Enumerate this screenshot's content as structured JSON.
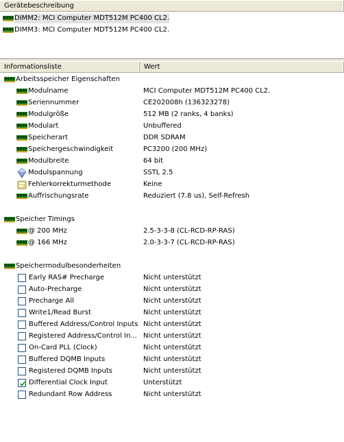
{
  "top": {
    "header": "Gerätebeschreibung",
    "devices": [
      {
        "label": "DIMM2: MCI Computer MDT512M PC400 CL2."
      },
      {
        "label": "DIMM3: MCI Computer MDT512M PC400 CL2."
      }
    ]
  },
  "bottom": {
    "col1": "Informationsliste",
    "col2": "Wert",
    "section1": {
      "title": "Arbeitsspeicher Eigenschaften",
      "rows": [
        {
          "name": "Modulname",
          "value": "MCI Computer MDT512M PC400 CL2."
        },
        {
          "name": "Seriennummer",
          "value": "CE202008h (136323278)"
        },
        {
          "name": "Modulgröße",
          "value": "512 MB (2 ranks, 4 banks)"
        },
        {
          "name": "Modulart",
          "value": "Unbuffered"
        },
        {
          "name": "Speicherart",
          "value": "DDR SDRAM"
        },
        {
          "name": "Speichergeschwindigkeit",
          "value": "PC3200 (200 MHz)"
        },
        {
          "name": "Modulbreite",
          "value": "64 bit"
        },
        {
          "name": "Modulspannung",
          "value": "SSTL 2.5"
        },
        {
          "name": "Fehlerkorrekturmethode",
          "value": "Keine"
        },
        {
          "name": "Auffrischungsrate",
          "value": "Reduziert (7.8 us), Self-Refresh"
        }
      ]
    },
    "section2": {
      "title": "Speicher Timings",
      "rows": [
        {
          "name": "@ 200 MHz",
          "value": "2.5-3-3-8  (CL-RCD-RP-RAS)"
        },
        {
          "name": "@ 166 MHz",
          "value": "2.0-3-3-7  (CL-RCD-RP-RAS)"
        }
      ]
    },
    "section3": {
      "title": "Speichermodulbesonderheiten",
      "rows": [
        {
          "name": "Early RAS# Precharge",
          "value": "Nicht unterstützt",
          "checked": false
        },
        {
          "name": "Auto-Precharge",
          "value": "Nicht unterstützt",
          "checked": false
        },
        {
          "name": "Precharge All",
          "value": "Nicht unterstützt",
          "checked": false
        },
        {
          "name": "Write1/Read Burst",
          "value": "Nicht unterstützt",
          "checked": false
        },
        {
          "name": "Buffered Address/Control Inputs",
          "value": "Nicht unterstützt",
          "checked": false
        },
        {
          "name": "Registered Address/Control In...",
          "value": "Nicht unterstützt",
          "checked": false
        },
        {
          "name": "On-Card PLL (Clock)",
          "value": "Nicht unterstützt",
          "checked": false
        },
        {
          "name": "Buffered DQMB Inputs",
          "value": "Nicht unterstützt",
          "checked": false
        },
        {
          "name": "Registered DQMB Inputs",
          "value": "Nicht unterstützt",
          "checked": false
        },
        {
          "name": "Differential Clock Input",
          "value": "Unterstützt",
          "checked": true
        },
        {
          "name": "Redundant Row Address",
          "value": "Nicht unterstützt",
          "checked": false
        }
      ]
    }
  }
}
